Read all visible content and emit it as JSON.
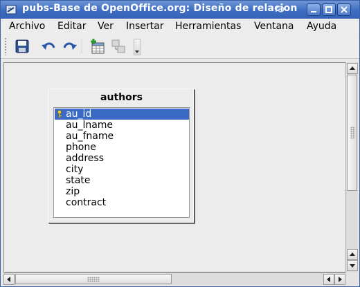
{
  "window": {
    "title": "pubs-Base de OpenOffice.org: Diseño de relacion"
  },
  "menubar": {
    "items": [
      {
        "label": "Archivo"
      },
      {
        "label": "Editar"
      },
      {
        "label": "Ver"
      },
      {
        "label": "Insertar"
      },
      {
        "label": "Herramientas"
      },
      {
        "label": "Ventana"
      },
      {
        "label": "Ayuda"
      }
    ]
  },
  "toolbar": {
    "buttons": [
      {
        "icon": "save-icon"
      },
      {
        "icon": "undo-icon"
      },
      {
        "icon": "redo-icon"
      },
      {
        "icon": "add-table-icon"
      },
      {
        "icon": "new-relation-icon"
      }
    ]
  },
  "table": {
    "name": "authors",
    "fields": [
      {
        "name": "au_id",
        "primary_key": true,
        "selected": true
      },
      {
        "name": "au_lname"
      },
      {
        "name": "au_fname"
      },
      {
        "name": "phone"
      },
      {
        "name": "address"
      },
      {
        "name": "city"
      },
      {
        "name": "state"
      },
      {
        "name": "zip"
      },
      {
        "name": "contract"
      }
    ]
  },
  "colors": {
    "titlebar": "#3d6cc0",
    "selection": "#3a6ac4"
  }
}
